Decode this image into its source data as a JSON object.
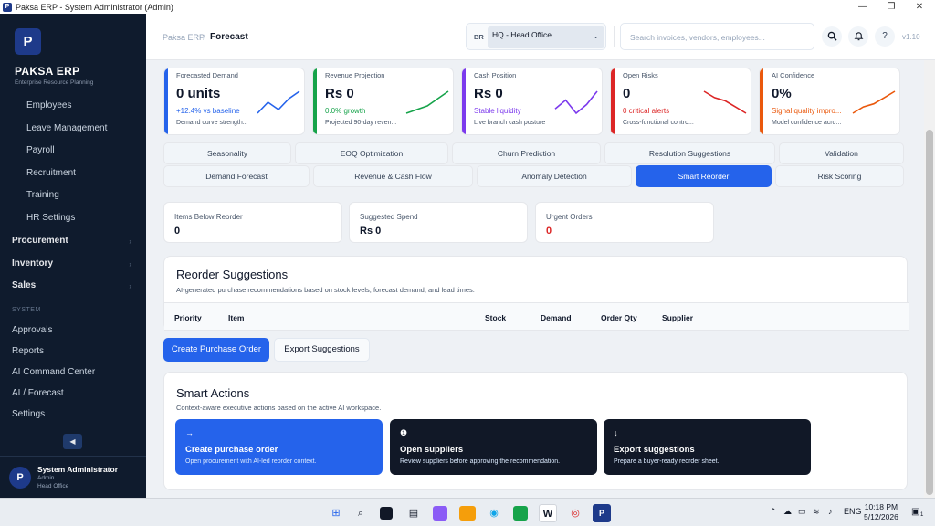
{
  "window": {
    "title": "Paksa ERP - System Administrator (Admin)",
    "app_icon": "P"
  },
  "sidebar": {
    "logo_letter": "P",
    "brand": "PAKSA ERP",
    "brand_sub": "Enterprise Resource Planning",
    "sub_items": [
      "Employees",
      "Leave Management",
      "Payroll",
      "Recruitment",
      "Training",
      "HR Settings"
    ],
    "groups": [
      "Procurement",
      "Inventory",
      "Sales"
    ],
    "section_label": "SYSTEM",
    "system_items": [
      "Approvals",
      "Reports",
      "AI Command Center",
      "AI / Forecast",
      "Settings"
    ],
    "collapse_icon": "◀",
    "user": {
      "avatar": "P",
      "name": "System Administrator",
      "role": "Admin",
      "branch": "Head Office"
    }
  },
  "header": {
    "breadcrumb_root": "Paksa ERP",
    "breadcrumb_sep": "/",
    "breadcrumb_current": "Forecast",
    "branch_code": "BR",
    "branch_value": "HQ - Head Office",
    "search_placeholder": "Search invoices, vendors, employees...",
    "version": "v1.10",
    "help": "?"
  },
  "kpis": [
    {
      "label": "Forecasted Demand",
      "value": "0 units",
      "delta": "+12.4% vs baseline",
      "desc": "Demand curve strength...",
      "color": "#2563eb",
      "delta_color": "#2563eb",
      "trend": [
        2,
        5,
        3,
        6,
        8
      ]
    },
    {
      "label": "Revenue Projection",
      "value": "Rs 0",
      "delta": "0.0% growth",
      "desc": "Projected 90-day reven...",
      "color": "#16a34a",
      "delta_color": "#16a34a",
      "trend": [
        2,
        3,
        4,
        6,
        8
      ]
    },
    {
      "label": "Cash Position",
      "value": "Rs 0",
      "delta": "Stable liquidity",
      "desc": "Live branch cash posture",
      "color": "#7c3aed",
      "delta_color": "#7c3aed",
      "trend": [
        4,
        6,
        3,
        5,
        8
      ]
    },
    {
      "label": "Open Risks",
      "value": "0",
      "delta": "0 critical alerts",
      "desc": "Cross-functional contro...",
      "color": "#dc2626",
      "delta_color": "#dc2626",
      "trend": [
        8,
        6,
        5,
        3,
        1
      ]
    },
    {
      "label": "AI Confidence",
      "value": "0%",
      "delta": "Signal quality impro...",
      "desc": "Model confidence acro...",
      "color": "#ea580c",
      "delta_color": "#ea580c",
      "trend": [
        1,
        3,
        4,
        6,
        8
      ]
    }
  ],
  "tabs_row1": [
    "Seasonality",
    "EOQ Optimization",
    "Churn Prediction",
    "Resolution Suggestions",
    "Validation"
  ],
  "tabs_row2": [
    "Demand Forecast",
    "Revenue & Cash Flow",
    "Anomaly Detection",
    "Smart Reorder",
    "Risk Scoring"
  ],
  "active_tab": "Smart Reorder",
  "stats": [
    {
      "label": "Items Below Reorder",
      "value": "0",
      "color": "#0f172a"
    },
    {
      "label": "Suggested Spend",
      "value": "Rs 0",
      "color": "#0f172a"
    },
    {
      "label": "Urgent Orders",
      "value": "0",
      "color": "#dc2626"
    }
  ],
  "reorder": {
    "title": "Reorder Suggestions",
    "subtitle": "AI-generated purchase recommendations based on stock levels, forecast demand, and lead times.",
    "columns": [
      "Priority",
      "Item",
      "Stock",
      "Demand",
      "Order Qty",
      "Supplier"
    ]
  },
  "buttons": {
    "create_po": "Create Purchase Order",
    "export": "Export Suggestions"
  },
  "smart_actions": {
    "title": "Smart Actions",
    "subtitle": "Context-aware executive actions based on the active AI workspace.",
    "items": [
      {
        "icon": "→",
        "title": "Create purchase order",
        "desc": "Open procurement with AI-led reorder context.",
        "bg": "#2563eb"
      },
      {
        "icon": "❶",
        "title": "Open suppliers",
        "desc": "Review suppliers before approving the recommendation.",
        "bg": "#111827"
      },
      {
        "icon": "↓",
        "title": "Export suggestions",
        "desc": "Prepare a buyer-ready reorder sheet.",
        "bg": "#111827"
      }
    ]
  },
  "taskbar": {
    "lang": "ENG",
    "time": "10:18 PM",
    "date": "5/12/2026",
    "notif": "1"
  }
}
